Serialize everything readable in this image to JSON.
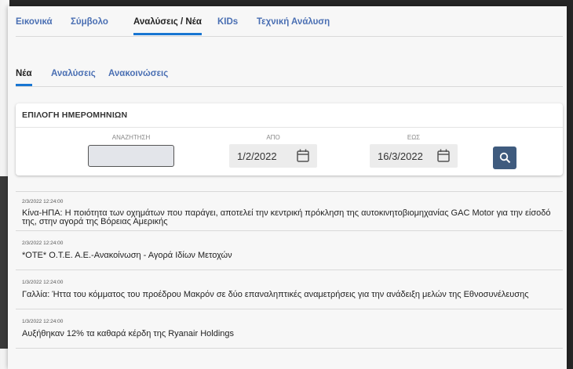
{
  "top_tabs": [
    "Εικονικά",
    "Σύμβολο",
    "Αναλύσεις / Νέα",
    "KIDs",
    "Τεχνική Ανάλυση"
  ],
  "sub_tabs": [
    "Νέα",
    "Αναλύσεις",
    "Ανακοινώσεις"
  ],
  "date_selection": {
    "title": "ΕΠΙΛΟΓΗ ΗΜΕΡΟΜΗΝΙΩΝ",
    "search_label": "ΑΝΑΖΗΤΗΣΗ",
    "search_value": "",
    "from_label": "ΑΠΟ",
    "from_value": "1/2/2022",
    "to_label": "ΕΩΣ",
    "to_value": "16/3/2022"
  },
  "news": [
    {
      "date": "2/3/2022 12:24:00",
      "title": "Κίνα-ΗΠΑ: Η ποιότητα των οχημάτων που παράγει, αποτελεί την κεντρική πρόκληση της αυτοκινητοβιομηχανίας GAC Motor για την είσοδό της, στην αγορά της Βόρειας Αμερικής"
    },
    {
      "date": "2/3/2022 12:24:00",
      "title": "*ΟΤΕ* Ο.Τ.Ε. Α.Ε.-Ανακοίνωση - Αγορά Ιδίων Μετοχών"
    },
    {
      "date": "1/3/2022 12:24:00",
      "title": "Γαλλία: Ήττα του κόμματος του προέδρου Μακρόν σε δύο επαναληπτικές αναμετρήσεις για την ανάδειξη μελών της Εθνοσυνέλευσης"
    },
    {
      "date": "1/3/2022 12:24:00",
      "title": "Αυξήθηκαν 12% τα καθαρά κέρδη της Ryanair Holdings"
    }
  ],
  "colors": {
    "accent": "#1976d2",
    "tab_inactive": "#4a6fb3",
    "search_button": "#3f5b7e"
  },
  "icons": [
    "calendar-icon",
    "search-icon"
  ]
}
